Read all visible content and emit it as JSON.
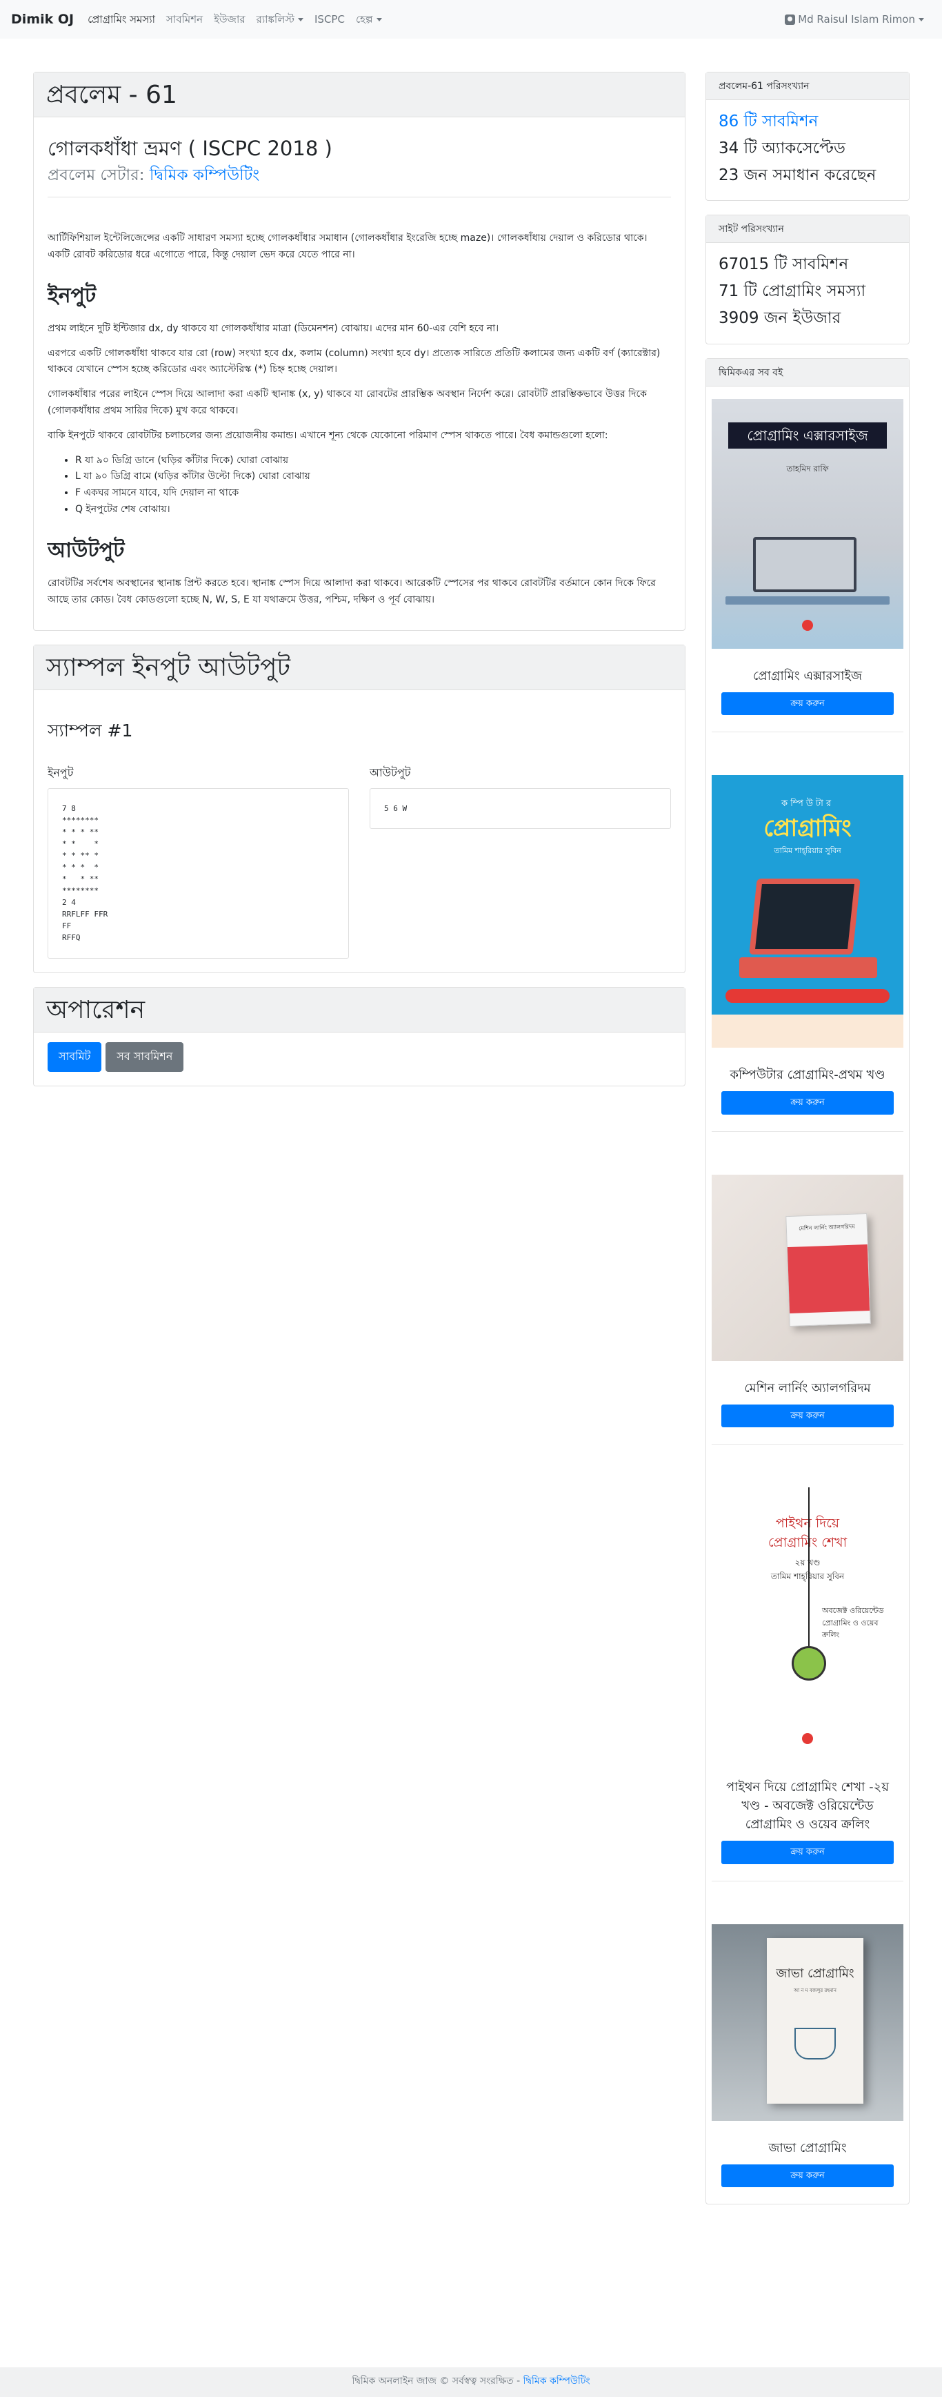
{
  "nav": {
    "brand": "Dimik OJ",
    "items": [
      {
        "label": "প্রোগ্রামিং সমস্যা",
        "active": true
      },
      {
        "label": "সাবমিশন"
      },
      {
        "label": "ইউজার"
      },
      {
        "label": "র‍্যাঙ্কলিস্ট",
        "dropdown": true
      },
      {
        "label": "ISCPC"
      },
      {
        "label": "হেল্প",
        "dropdown": true
      }
    ],
    "user": "Md Raisul Islam Rimon"
  },
  "problem": {
    "header": "প্রবলেম - 61",
    "title": "গোলকধাঁধা ভ্রমণ ( ISCPC 2018 )",
    "setter_label": "প্রবলেম সেটার:",
    "setter_name": "দ্বিমিক কম্পিউটিং",
    "intro": "আর্টিফিশিয়াল ইন্টেলিজেন্সের একটি সাধারণ সমস্যা হচ্ছে গোলকধাঁধার সমাধান (গোলকধাঁধার ইংরেজি হচ্ছে maze)। গোলকধাঁধায় দেয়াল ও করিডোর থাকে। একটি রোবট করিডোর ধরে এগোতে পারে, কিন্তু দেয়াল ভেদ করে যেতে পারে না।",
    "input_heading": "ইনপুট",
    "input_paras": [
      "প্রথম লাইনে দুটি ইন্টিজার dx, dy থাকবে যা গোলকধাঁধার মাত্রা (ডিমেনশন) বোঝায়। এদের মান 60-এর বেশি হবে না।",
      "এরপরে একটি গোলকধাঁধা থাকবে যার রো (row) সংখ্যা হবে dx, কলাম (column) সংখ্যা হবে dy। প্রত্যেক সারিতে প্রতিটি কলামের জন্য একটি বর্ণ (ক্যারেক্টার) থাকবে যেখানে স্পেস হচ্ছে করিডোর এবং অ্যাস্টেরিস্ক (*) চিহ্ন হচ্ছে দেয়াল।",
      "গোলকধাঁধার পরের লাইনে স্পেস দিয়ে আলাদা করা একটি স্থানাঙ্ক (x, y) থাকবে যা রোবটের প্রারম্ভিক অবস্থান নির্দেশ করে। রোবটটি প্রারম্ভিকভাবে উত্তর দিকে (গোলকধাঁধার প্রথম সারির দিকে) মুখ করে থাকবে।",
      "বাকি ইনপুটে থাকবে রোবটটির চলাচলের জন্য প্রয়োজনীয় কমান্ড। এখানে শূন্য থেকে যেকোনো পরিমাণ স্পেস থাকতে পারে। বৈধ কমান্ডগুলো হলো:"
    ],
    "commands": [
      "R যা ৯০ ডিগ্রি ডানে (ঘড়ির কাঁটার দিকে) ঘোরা বোঝায়",
      "L যা ৯০ ডিগ্রি বামে (ঘড়ির কাঁটার উল্টো দিকে) ঘোরা বোঝায়",
      "F একঘর সামনে যাবে, যদি দেয়াল না থাকে",
      "Q ইনপুটের শেষ বোঝায়।"
    ],
    "output_heading": "আউটপুট",
    "output_para": "রোবটটির সর্বশেষ অবস্থানের স্থানাঙ্ক প্রিন্ট করতে হবে। স্থানাঙ্ক স্পেস দিয়ে আলাদা করা থাকবে। আরেকটি স্পেসের পর থাকবে রোবটটির বর্তমানে কোন দিকে ফিরে আছে তার কোড। বৈধ কোডগুলো হচ্ছে N, W, S, E যা যথাক্রমে উত্তর, পশ্চিম, দক্ষিণ ও পূর্ব বোঝায়।"
  },
  "sample": {
    "header": "স্যাম্পল ইনপুট আউটপুট",
    "title": "স্যাম্পল #1",
    "input_label": "ইনপুট",
    "output_label": "আউটপুট",
    "input": "7 8\n********\n* * * **\n* *    *\n* * ** *\n* * *  *\n*   * **\n********\n2 4\nRRFLFF FFR\nFF\nRFFQ",
    "output": "5 6 W"
  },
  "operation": {
    "header": "অপারেশন",
    "submit": "সাবমিট",
    "all_submissions": "সব সাবমিশন"
  },
  "stats": {
    "problem_header": "প্রবলেম-61 পরিসংখ্যান",
    "submissions": "86 টি সাবমিশন",
    "accepted": "34 টি অ্যাকসেপ্টেড",
    "solved_by": "23 জন সমাধান করেছেন",
    "site_header": "সাইট পরিসংখ্যান",
    "site_submissions": "67015 টি সাবমিশন",
    "site_problems": "71 টি প্রোগ্রামিং সমস্যা",
    "site_users": "3909 জন ইউজার"
  },
  "books": {
    "header": "দ্বিমিকএর সব বই",
    "buy_label": "ক্রয় করুন",
    "items": [
      {
        "title": "প্রোগ্রামিং এক্সারসাইজ",
        "cover_title": "প্রোগ্রামিং এক্সারসাইজ",
        "cover_author": "তাহমিদ রাফি"
      },
      {
        "title": "কম্পিউটার প্রোগ্রামিং-প্রথম খণ্ড",
        "cover_title": "প্রোগ্রামিং",
        "cover_sub": "কম্পিউটার",
        "cover_author": "তামিম শাহ্‌রিয়ার সুবিন"
      },
      {
        "title": "মেশিন লার্নিং অ্যালগরিদম",
        "cover_title": "মেশিন লার্নিং অ্যালগরিদম"
      },
      {
        "title": "পাইথন দিয়ে প্রোগ্রামিং শেখা -২য় খণ্ড - অবজেক্ট ওরিয়েন্টেড প্রোগ্রামিং ও ওয়েব ক্রলিং",
        "cover_title_1": "পাইথন দিয়ে",
        "cover_title_2": "প্রোগ্রামিং শেখা",
        "cover_vol": "২য় খণ্ড",
        "cover_author": "তামিম শাহ্‌রিয়ার সুবিন",
        "cover_sub": "অবজেক্ট ওরিয়েন্টেড প্রোগ্রামিং ও ওয়েব ক্রলিং"
      },
      {
        "title": "জাভা প্রোগ্রামিং",
        "cover_title": "জাভা প্রোগ্রামিং",
        "cover_author": "আ ন ম বজলুর রহমান"
      }
    ]
  },
  "footer": {
    "text": "দ্বিমিক অনলাইন জাজ © সর্বস্বত্ব সংরক্ষিত -",
    "link": "দ্বিমিক কম্পিউটিং"
  },
  "colors": {
    "primary": "#007bff",
    "secondary": "#6c757d",
    "header_bg": "#f0f1f2"
  }
}
